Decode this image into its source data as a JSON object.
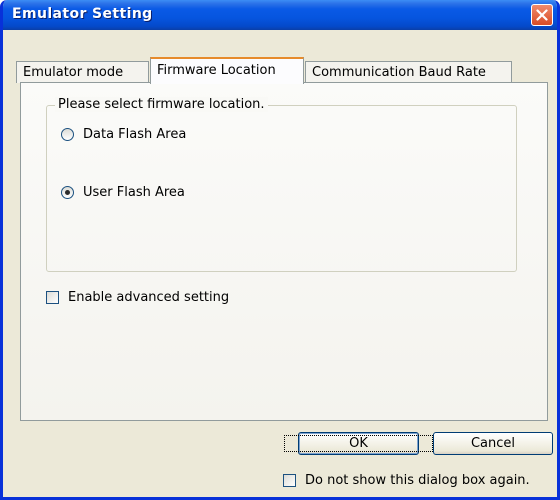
{
  "window": {
    "title": "Emulator Setting"
  },
  "tabs": [
    {
      "label": "Emulator mode",
      "active": false
    },
    {
      "label": "Firmware Location",
      "active": true
    },
    {
      "label": "Communication Baud Rate",
      "active": false
    }
  ],
  "firmware_location": {
    "group_label": "Please select firmware location.",
    "options": [
      {
        "label": "Data Flash Area",
        "selected": false
      },
      {
        "label": "User Flash Area",
        "selected": true
      }
    ]
  },
  "advanced": {
    "label": "Enable advanced setting",
    "checked": false
  },
  "buttons": {
    "ok_label": "OK",
    "cancel_label": "Cancel"
  },
  "footer": {
    "dont_show_label": "Do not show this dialog box again.",
    "checked": false
  },
  "colors": {
    "title_bar": "#0655df",
    "close_button": "#d94c25",
    "dialog_background": "#ece9d8",
    "active_tab_highlight": "#e68b2c"
  }
}
